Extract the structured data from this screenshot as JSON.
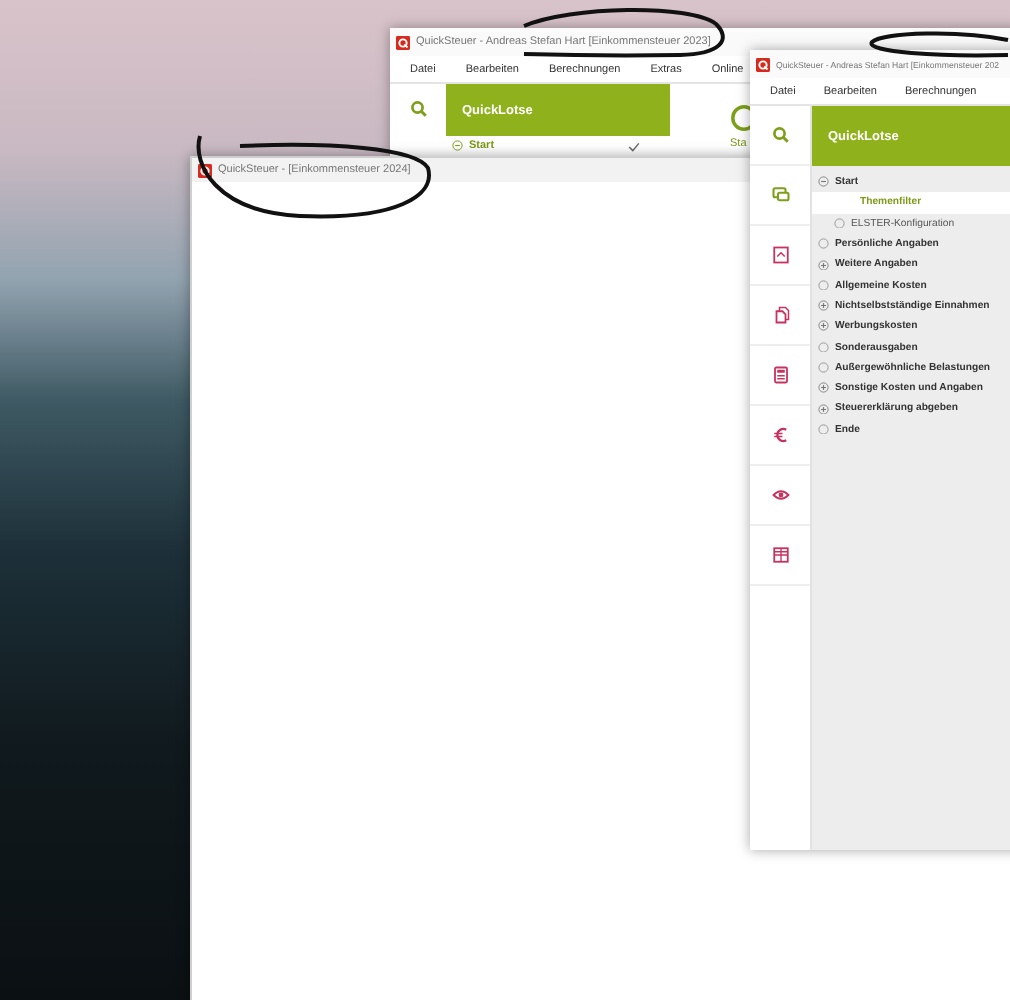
{
  "back_window": {
    "title": "QuickSteuer - Andreas Stefan Hart [Einkommensteuer 2023]",
    "menu": [
      "Datei",
      "Bearbeiten",
      "Berechnungen",
      "Extras",
      "Online"
    ],
    "panel_title": "QuickLotse",
    "items": [
      {
        "label": "Start",
        "expanded": true,
        "checked": true
      }
    ],
    "step_label": "Sta"
  },
  "middle_window": {
    "title": "QuickSteuer - [Einkommensteuer 2024]"
  },
  "front_window": {
    "title": "QuickSteuer - Andreas Stefan Hart [Einkommensteuer 202",
    "menu": [
      "Datei",
      "Bearbeiten",
      "Berechnungen"
    ],
    "panel_title": "QuickLotse",
    "items": [
      {
        "label": "Start",
        "kind": "group",
        "expanded": true,
        "selected": false,
        "children": [
          {
            "label": "Themenfilter",
            "kind": "topic",
            "selected": true
          },
          {
            "label": "ELSTER-Konfiguration",
            "kind": "page",
            "selected": false
          }
        ]
      },
      {
        "label": "Persönliche Angaben",
        "kind": "page",
        "selected": false
      },
      {
        "label": "Weitere Angaben",
        "kind": "group",
        "expanded": false,
        "selected": false
      },
      {
        "label": "Allgemeine Kosten",
        "kind": "page",
        "selected": false
      },
      {
        "label": "Nichtselbstständige Einnahmen",
        "kind": "group",
        "expanded": false,
        "selected": false
      },
      {
        "label": "Werbungskosten",
        "kind": "group",
        "expanded": false,
        "selected": false
      },
      {
        "label": "Sonderausgaben",
        "kind": "page",
        "selected": false
      },
      {
        "label": "Außergewöhnliche Belastungen",
        "kind": "page",
        "selected": false
      },
      {
        "label": "Sonstige Kosten und Angaben",
        "kind": "group",
        "expanded": false,
        "selected": false
      },
      {
        "label": "Steuererklärung abgeben",
        "kind": "group",
        "expanded": false,
        "selected": false
      },
      {
        "label": "Ende",
        "kind": "page",
        "selected": false
      }
    ]
  }
}
